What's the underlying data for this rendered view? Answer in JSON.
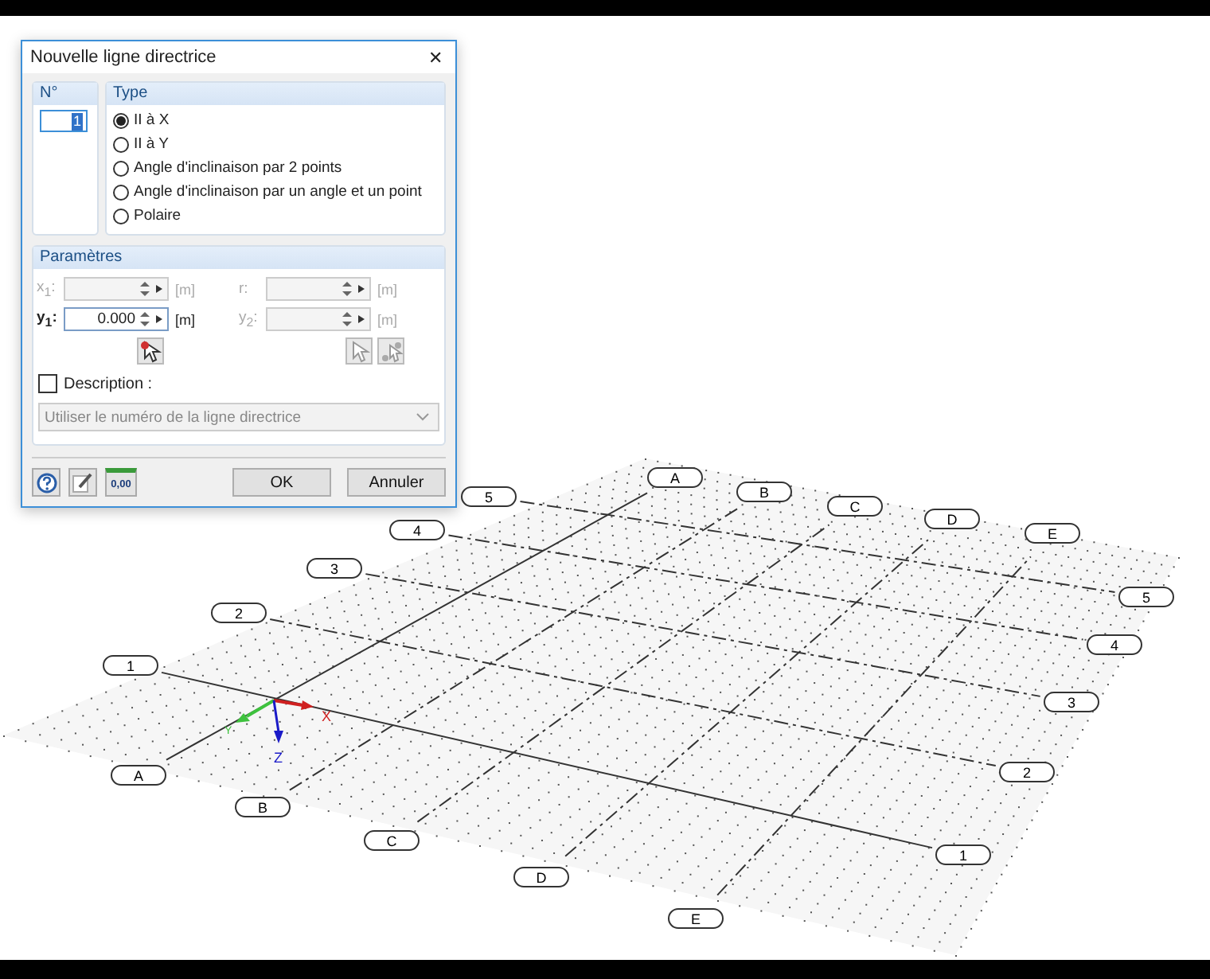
{
  "dialog": {
    "title": "Nouvelle ligne directrice",
    "close": "✕",
    "number": {
      "label": "N°",
      "value": "1"
    },
    "type": {
      "label": "Type",
      "options": [
        {
          "label": "II à X",
          "selected": true
        },
        {
          "label": "II à Y",
          "selected": false
        },
        {
          "label": "Angle d'inclinaison par 2 points",
          "selected": false
        },
        {
          "label": "Angle d'inclinaison par un angle et un point",
          "selected": false
        },
        {
          "label": "Polaire",
          "selected": false
        }
      ]
    },
    "parameters": {
      "label": "Paramètres",
      "fields": [
        {
          "label": "x$_{1}$:",
          "unit": "[m]",
          "disabled": true
        },
        {
          "label": "r:",
          "unit": "[m]",
          "disabled": true
        },
        {
          "label": "y$_{1}$:",
          "value": "0.000",
          "unit": "[m]",
          "disabled": false
        },
        {
          "label": "y$_{2}$:",
          "unit": "[m]",
          "disabled": true
        }
      ]
    },
    "description": {
      "label": "Description :",
      "checked": false,
      "value": "Utiliser le numéro de la ligne directrice",
      "disabled": true
    },
    "units_button": "0,00",
    "buttons": [
      "OK",
      "Annuler"
    ]
  },
  "grid": {
    "numbered": [
      {
        "start": "1",
        "end": "1",
        "dashed": false
      },
      {
        "start": "2",
        "end": "2",
        "dashed": true
      },
      {
        "start": "3",
        "end": "3",
        "dashed": true
      },
      {
        "start": "4",
        "end": "4",
        "dashed": true
      },
      {
        "start": "5",
        "end": "5",
        "dashed": true
      }
    ],
    "lettered": [
      {
        "start": "A",
        "end": "A",
        "dashed": false
      },
      {
        "start": "B",
        "end": "B",
        "dashed": true
      },
      {
        "start": "C",
        "end": "C",
        "dashed": true
      },
      {
        "start": "D",
        "end": "D",
        "dashed": true
      },
      {
        "start": "E",
        "end": "E",
        "dashed": true
      }
    ],
    "axes": {
      "x": "X",
      "y": "Y",
      "z": "Z"
    }
  }
}
